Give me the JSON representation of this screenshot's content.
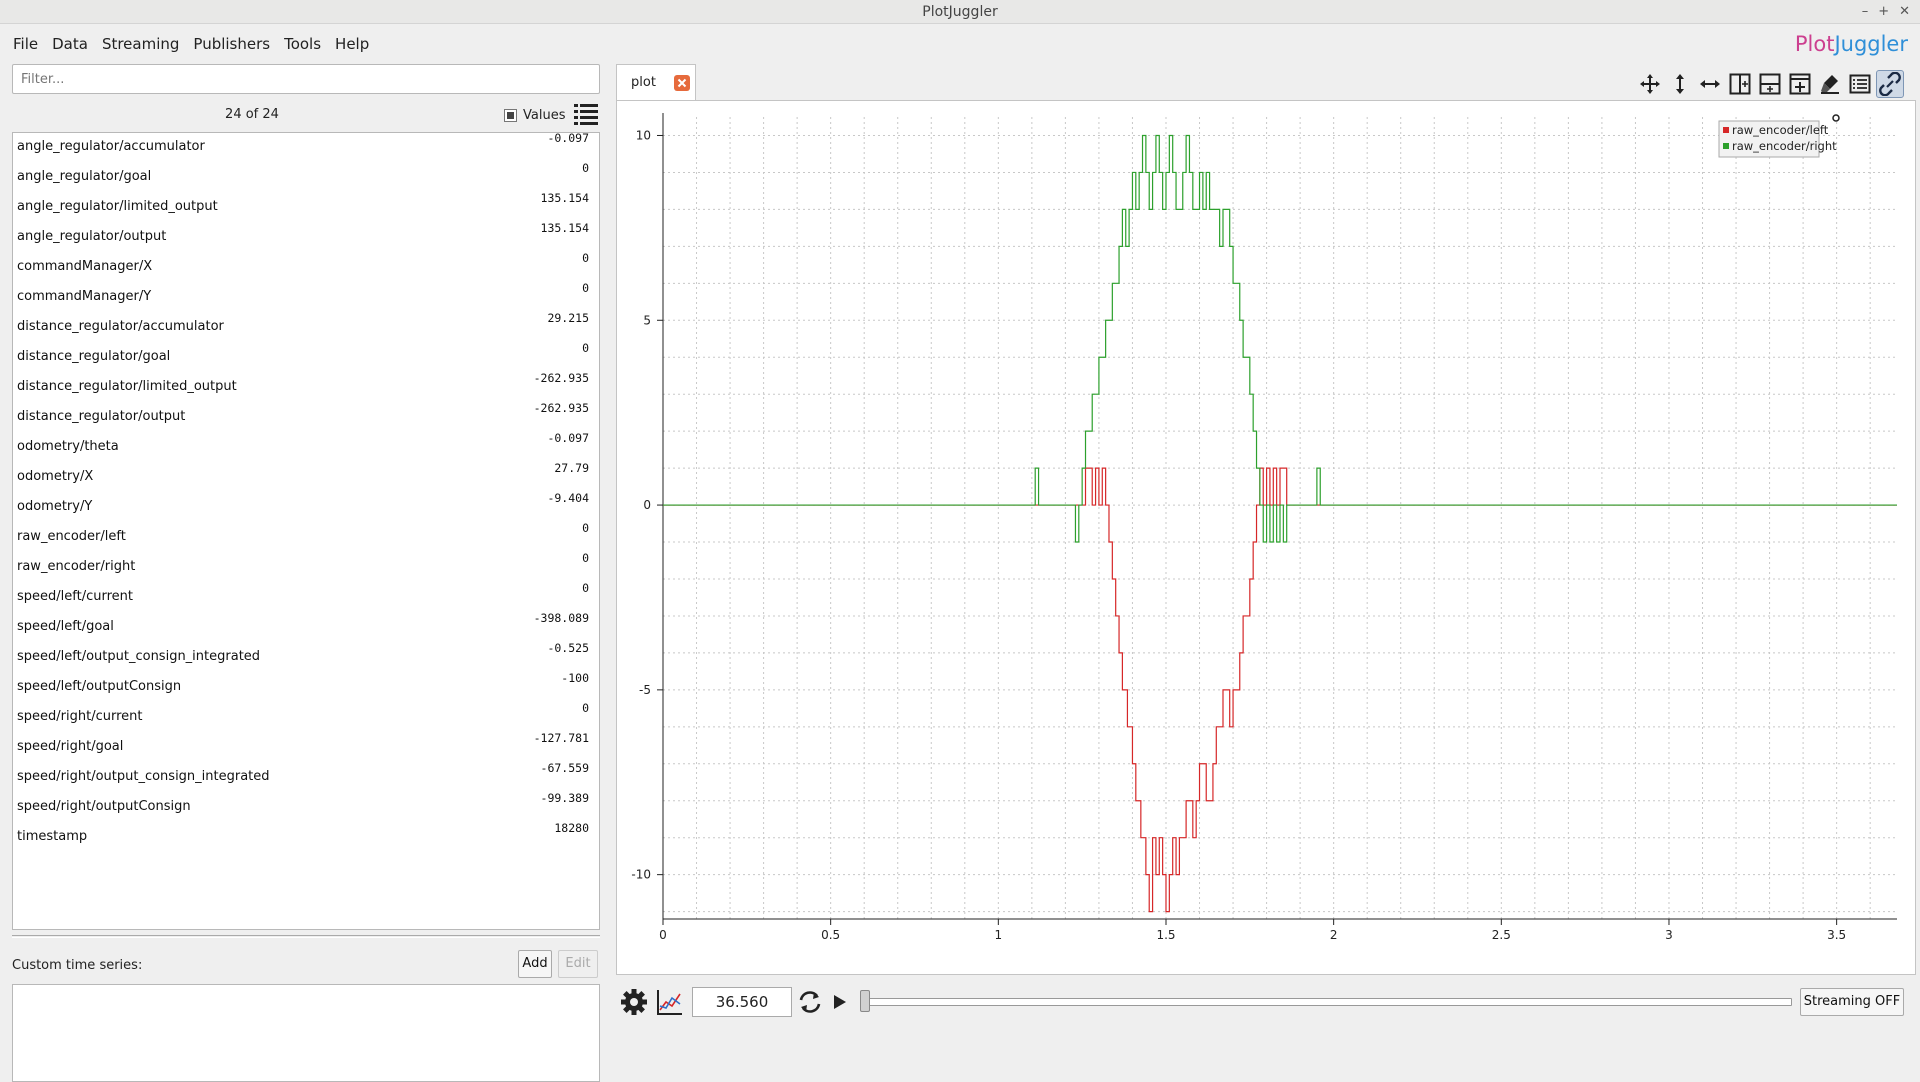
{
  "window": {
    "title": "PlotJuggler"
  },
  "menu": [
    "File",
    "Data",
    "Streaming",
    "Publishers",
    "Tools",
    "Help"
  ],
  "brand": {
    "part1": "Plot",
    "part2": "Juggler"
  },
  "sidebar": {
    "filter_placeholder": "Filter...",
    "counter": "24 of 24",
    "values_label": "Values",
    "items": [
      {
        "name": "angle_regulator/accumulator",
        "value": "-0.097"
      },
      {
        "name": "angle_regulator/goal",
        "value": "0"
      },
      {
        "name": "angle_regulator/limited_output",
        "value": "135.154"
      },
      {
        "name": "angle_regulator/output",
        "value": "135.154"
      },
      {
        "name": "commandManager/X",
        "value": "0"
      },
      {
        "name": "commandManager/Y",
        "value": "0"
      },
      {
        "name": "distance_regulator/accumulator",
        "value": "29.215"
      },
      {
        "name": "distance_regulator/goal",
        "value": "0"
      },
      {
        "name": "distance_regulator/limited_output",
        "value": "-262.935"
      },
      {
        "name": "distance_regulator/output",
        "value": "-262.935"
      },
      {
        "name": "odometry/theta",
        "value": "-0.097"
      },
      {
        "name": "odometry/X",
        "value": "27.79"
      },
      {
        "name": "odometry/Y",
        "value": "-9.404"
      },
      {
        "name": "raw_encoder/left",
        "value": "0"
      },
      {
        "name": "raw_encoder/right",
        "value": "0"
      },
      {
        "name": "speed/left/current",
        "value": "0"
      },
      {
        "name": "speed/left/goal",
        "value": "-398.089"
      },
      {
        "name": "speed/left/output_consign_integrated",
        "value": "-0.525"
      },
      {
        "name": "speed/left/outputConsign",
        "value": "-100"
      },
      {
        "name": "speed/right/current",
        "value": "0"
      },
      {
        "name": "speed/right/goal",
        "value": "-127.781"
      },
      {
        "name": "speed/right/output_consign_integrated",
        "value": "-67.559"
      },
      {
        "name": "speed/right/outputConsign",
        "value": "-99.389"
      },
      {
        "name": "timestamp",
        "value": "18280"
      }
    ],
    "custom_label": "Custom time series:",
    "add_label": "Add",
    "edit_label": "Edit"
  },
  "tab": {
    "label": "plot"
  },
  "toolbar_icons": [
    "move-icon",
    "zoom-vertical-icon",
    "zoom-horizontal-icon",
    "split-horizontal-icon",
    "split-vertical-icon",
    "add-plot-icon",
    "clear-icon",
    "legend-icon",
    "link-icon"
  ],
  "bottom": {
    "time_value": "36.560",
    "streaming_label": "Streaming OFF"
  },
  "colors": {
    "left": "#d62728",
    "right": "#2ca02c",
    "brand1": "#cc3f8f",
    "brand2": "#2f8fd8"
  },
  "chart_data": {
    "type": "line",
    "xlim": [
      0,
      3.68
    ],
    "ylim": [
      -11.2,
      10.5
    ],
    "x_ticks": [
      0,
      0.5,
      1,
      1.5,
      2,
      2.5,
      3,
      3.5
    ],
    "x_tick_labels": [
      "0",
      "0.5",
      "1",
      "1.5",
      "2",
      "2.5",
      "3",
      "3.5"
    ],
    "y_ticks": [
      10,
      5,
      0,
      -5,
      -10
    ],
    "y_tick_labels": [
      "10",
      "5",
      "0",
      "-5",
      "-10"
    ],
    "grid": true,
    "legend_position": "top-right",
    "series": [
      {
        "name": "raw_encoder/left",
        "color": "#d62728",
        "points": [
          [
            0,
            0
          ],
          [
            1.2,
            0
          ],
          [
            1.24,
            0
          ],
          [
            1.26,
            1
          ],
          [
            1.28,
            0
          ],
          [
            1.29,
            1
          ],
          [
            1.3,
            0
          ],
          [
            1.31,
            1
          ],
          [
            1.32,
            0
          ],
          [
            1.33,
            -1
          ],
          [
            1.34,
            -2
          ],
          [
            1.35,
            -3
          ],
          [
            1.36,
            -4
          ],
          [
            1.37,
            -5
          ],
          [
            1.385,
            -6
          ],
          [
            1.4,
            -7
          ],
          [
            1.41,
            -8
          ],
          [
            1.425,
            -9
          ],
          [
            1.44,
            -10
          ],
          [
            1.45,
            -11
          ],
          [
            1.46,
            -9
          ],
          [
            1.47,
            -10
          ],
          [
            1.48,
            -9
          ],
          [
            1.49,
            -10
          ],
          [
            1.5,
            -11
          ],
          [
            1.51,
            -10
          ],
          [
            1.52,
            -9
          ],
          [
            1.53,
            -10
          ],
          [
            1.54,
            -9
          ],
          [
            1.56,
            -8
          ],
          [
            1.58,
            -9
          ],
          [
            1.59,
            -8
          ],
          [
            1.6,
            -7
          ],
          [
            1.62,
            -8
          ],
          [
            1.64,
            -7
          ],
          [
            1.65,
            -6
          ],
          [
            1.67,
            -5
          ],
          [
            1.69,
            -6
          ],
          [
            1.7,
            -5
          ],
          [
            1.72,
            -4
          ],
          [
            1.73,
            -3
          ],
          [
            1.75,
            -2
          ],
          [
            1.76,
            -1
          ],
          [
            1.77,
            0
          ],
          [
            1.78,
            1
          ],
          [
            1.79,
            0
          ],
          [
            1.8,
            1
          ],
          [
            1.81,
            0
          ],
          [
            1.82,
            1
          ],
          [
            1.83,
            0
          ],
          [
            1.84,
            1
          ],
          [
            1.86,
            0
          ],
          [
            3.68,
            0
          ]
        ]
      },
      {
        "name": "raw_encoder/right",
        "color": "#2ca02c",
        "points": [
          [
            0,
            0
          ],
          [
            1.1,
            0
          ],
          [
            1.11,
            1
          ],
          [
            1.12,
            0
          ],
          [
            1.22,
            0
          ],
          [
            1.23,
            -1
          ],
          [
            1.24,
            0
          ],
          [
            1.25,
            1
          ],
          [
            1.26,
            2
          ],
          [
            1.28,
            3
          ],
          [
            1.3,
            4
          ],
          [
            1.32,
            5
          ],
          [
            1.34,
            6
          ],
          [
            1.36,
            7
          ],
          [
            1.37,
            8
          ],
          [
            1.38,
            7
          ],
          [
            1.39,
            8
          ],
          [
            1.4,
            9
          ],
          [
            1.41,
            8
          ],
          [
            1.42,
            9
          ],
          [
            1.43,
            10
          ],
          [
            1.44,
            9
          ],
          [
            1.45,
            8
          ],
          [
            1.46,
            9
          ],
          [
            1.47,
            10
          ],
          [
            1.48,
            9
          ],
          [
            1.49,
            8
          ],
          [
            1.5,
            9
          ],
          [
            1.51,
            10
          ],
          [
            1.52,
            9
          ],
          [
            1.53,
            8
          ],
          [
            1.55,
            9
          ],
          [
            1.56,
            10
          ],
          [
            1.57,
            9
          ],
          [
            1.58,
            8
          ],
          [
            1.6,
            9
          ],
          [
            1.61,
            8
          ],
          [
            1.62,
            9
          ],
          [
            1.63,
            8
          ],
          [
            1.65,
            8
          ],
          [
            1.66,
            7
          ],
          [
            1.67,
            8
          ],
          [
            1.69,
            7
          ],
          [
            1.7,
            6
          ],
          [
            1.72,
            5
          ],
          [
            1.73,
            4
          ],
          [
            1.75,
            3
          ],
          [
            1.76,
            2
          ],
          [
            1.77,
            1
          ],
          [
            1.78,
            0
          ],
          [
            1.79,
            -1
          ],
          [
            1.8,
            0
          ],
          [
            1.81,
            -1
          ],
          [
            1.82,
            0
          ],
          [
            1.83,
            -1
          ],
          [
            1.84,
            0
          ],
          [
            1.85,
            -1
          ],
          [
            1.86,
            0
          ],
          [
            1.94,
            0
          ],
          [
            1.95,
            1
          ],
          [
            1.96,
            0
          ],
          [
            3.68,
            0
          ]
        ]
      }
    ]
  }
}
